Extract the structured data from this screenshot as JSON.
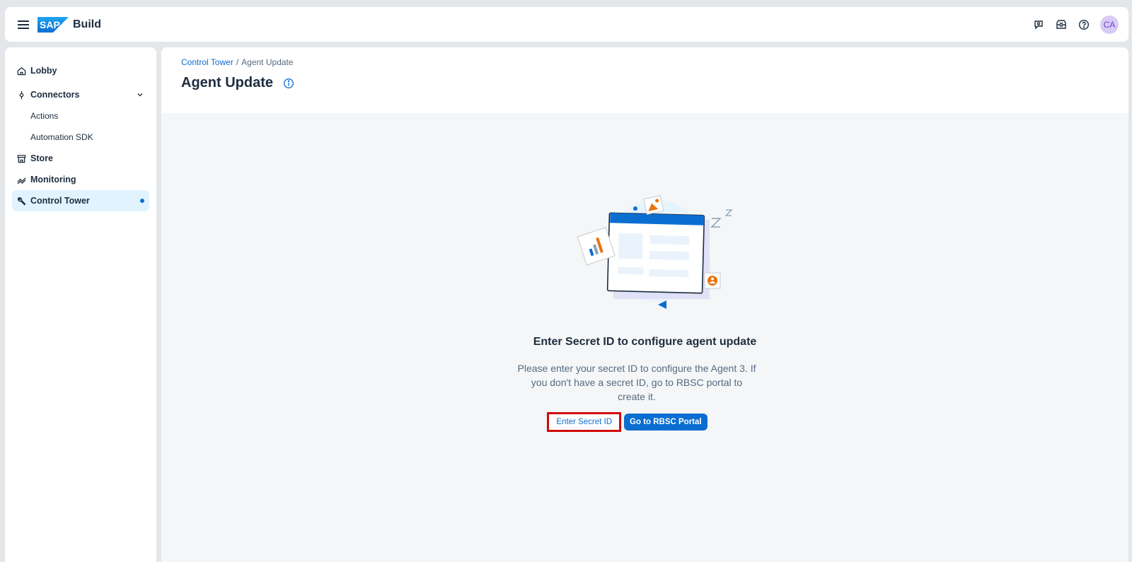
{
  "shell": {
    "logo_text": "SAP",
    "product": "Build",
    "avatar_initials": "CA",
    "icons": [
      "menu-icon",
      "chat-icon",
      "inbox-icon",
      "help-icon"
    ]
  },
  "sidebar": {
    "items": [
      {
        "label": "Lobby",
        "icon": "home-icon"
      },
      {
        "label": "Connectors",
        "icon": "connector-icon"
      },
      {
        "label": "Actions"
      },
      {
        "label": "Automation SDK"
      },
      {
        "label": "Store",
        "icon": "store-icon"
      },
      {
        "label": "Monitoring",
        "icon": "monitoring-icon"
      },
      {
        "label": "Control Tower",
        "icon": "wrench-icon",
        "active": true
      }
    ]
  },
  "page": {
    "breadcrumb": [
      "Control Tower",
      "/",
      "Agent Update"
    ],
    "title": "Agent Update"
  },
  "empty_state": {
    "title": "Enter Secret ID to configure agent update",
    "message": "Please enter your secret ID to configure the Agent 3. If you don't have a secret ID, go to RBSC portal to create it.",
    "primary_button": "Go to RBSC Portal",
    "secondary_button": "Enter Secret ID"
  },
  "colors": {
    "accent": "#0a6ed1",
    "highlight_border": "#d20a0a",
    "active_nav_bg": "#e1f3ff"
  }
}
